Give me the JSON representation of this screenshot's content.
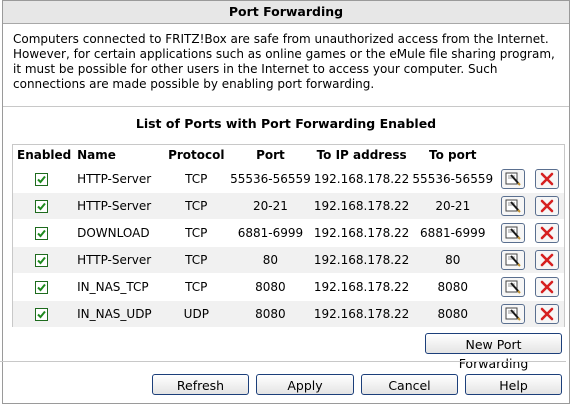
{
  "window": {
    "title": "Port Forwarding"
  },
  "intro": {
    "text": "Computers connected to FRITZ!Box are safe from unauthorized access from the Internet. However, for certain applications such as online games or the eMule file sharing program, it must be possible for other users in the Internet to access your computer. Such connections are made possible by enabling port forwarding."
  },
  "table": {
    "title": "List of Ports with Port Forwarding Enabled",
    "columns": [
      "Enabled",
      "Name",
      "Protocol",
      "Port",
      "To IP address",
      "To port"
    ],
    "rows": [
      {
        "enabled": true,
        "name": "HTTP-Server",
        "protocol": "TCP",
        "port": "55536-56559",
        "ip": "192.168.178.22",
        "to_port": "55536-56559"
      },
      {
        "enabled": true,
        "name": "HTTP-Server",
        "protocol": "TCP",
        "port": "20-21",
        "ip": "192.168.178.22",
        "to_port": "20-21"
      },
      {
        "enabled": true,
        "name": "DOWNLOAD",
        "protocol": "TCP",
        "port": "6881-6999",
        "ip": "192.168.178.22",
        "to_port": "6881-6999"
      },
      {
        "enabled": true,
        "name": "HTTP-Server",
        "protocol": "TCP",
        "port": "80",
        "ip": "192.168.178.22",
        "to_port": "80"
      },
      {
        "enabled": true,
        "name": "IN_NAS_TCP",
        "protocol": "TCP",
        "port": "8080",
        "ip": "192.168.178.22",
        "to_port": "8080"
      },
      {
        "enabled": true,
        "name": "IN_NAS_UDP",
        "protocol": "UDP",
        "port": "8080",
        "ip": "192.168.178.22",
        "to_port": "8080"
      }
    ],
    "icons": {
      "edit": "edit-icon",
      "delete": "delete-icon"
    }
  },
  "buttons": {
    "new": "New Port Forwarding",
    "refresh": "Refresh",
    "apply": "Apply",
    "cancel": "Cancel",
    "help": "Help"
  },
  "colors": {
    "check": "#1e8a1e",
    "delete": "#d62020",
    "button_border": "#1c3f7a"
  }
}
